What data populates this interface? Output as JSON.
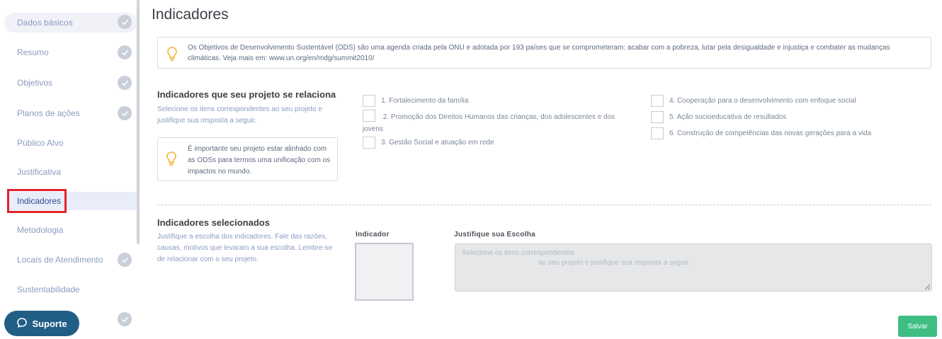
{
  "sidebar": {
    "items": [
      {
        "label": "Dados básicos",
        "checked": true
      },
      {
        "label": "Resumo",
        "checked": true
      },
      {
        "label": "Objetivos",
        "checked": true
      },
      {
        "label": "Planos de ações",
        "checked": true
      },
      {
        "label": "Público Alvo",
        "checked": false
      },
      {
        "label": "Justificativa",
        "checked": false
      },
      {
        "label": "Indicadores",
        "checked": false,
        "active": true
      },
      {
        "label": "Metodologia",
        "checked": false
      },
      {
        "label": "Locais de Atendimento",
        "checked": true
      },
      {
        "label": "Sustentabilidade",
        "checked": false
      },
      {
        "label": "",
        "checked": true
      }
    ],
    "support_label": "Suporte"
  },
  "page": {
    "title": "Indicadores",
    "info_text": "Os Objetivos de Desenvolvimento Sustentável (ODS) são uma agenda criada pela ONU e adotada por 193 países que se comprometeram: acabar com a pobreza, lutar pela desigualdade e injustiça e combater as mudanças climáticas. Veja mais em: www.un.org/en/mdg/summit2010/"
  },
  "related": {
    "title": "Indicadores que seu projeto se relaciona",
    "description": "Selecione os itens correspondentes ao seu projeto e justifique sua resposta a seguir.",
    "tip": "É importante seu projeto estar alinhado com as ODSs para termos uma unificação com os impactos no mundo.",
    "options": [
      "1. Fortalecimento da família",
      "2. Promoção dos Direitos Humanos das crianças, dos adolescentes e dos jovens",
      "3. Gestão Social e atuação em rede",
      "4. Cooperação para o desenvolvimento com enfoque social",
      "5. Ação socioeducativa de resultados",
      "6. Construção de competências das novas gerações para a vida"
    ]
  },
  "selected": {
    "title": "Indicadores selecionados",
    "description": "Justifique a escolha dos indicadores. Fale das razões, causas, motivos que levaram a sua escolha. Lembre-se de relacionar com o seu projeto.",
    "indicator_label": "Indicador",
    "justify_label": "Justifique sua Escolha",
    "justify_placeholder_1": "Selecione os itens correspondentes",
    "justify_placeholder_2": "ao seu projeto e justifique sua resposta a seguir."
  },
  "actions": {
    "save_label": "Salvar"
  },
  "colors": {
    "accent": "#205e85",
    "save": "#3fbe84",
    "highlight": "#e0242c",
    "link": "#8a9cc0"
  },
  "icons": {
    "check": "check-icon",
    "bulb": "lightbulb-icon",
    "chat": "chat-bubble-icon"
  }
}
